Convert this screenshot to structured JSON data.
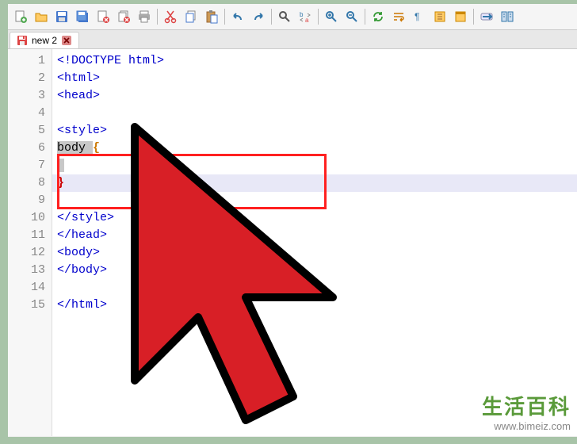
{
  "toolbar": {
    "buttons": [
      {
        "name": "new-file-icon",
        "title": "New"
      },
      {
        "name": "open-file-icon",
        "title": "Open"
      },
      {
        "name": "save-icon",
        "title": "Save"
      },
      {
        "name": "save-all-icon",
        "title": "Save All"
      },
      {
        "name": "close-icon",
        "title": "Close"
      },
      {
        "name": "close-all-icon",
        "title": "Close All"
      },
      {
        "name": "print-icon",
        "title": "Print"
      },
      {
        "name": "sep"
      },
      {
        "name": "cut-icon",
        "title": "Cut"
      },
      {
        "name": "copy-icon",
        "title": "Copy"
      },
      {
        "name": "paste-icon",
        "title": "Paste"
      },
      {
        "name": "sep"
      },
      {
        "name": "undo-icon",
        "title": "Undo"
      },
      {
        "name": "redo-icon",
        "title": "Redo"
      },
      {
        "name": "sep"
      },
      {
        "name": "find-icon",
        "title": "Find"
      },
      {
        "name": "replace-icon",
        "title": "Replace"
      },
      {
        "name": "sep"
      },
      {
        "name": "zoom-in-icon",
        "title": "Zoom In"
      },
      {
        "name": "zoom-out-icon",
        "title": "Zoom Out"
      },
      {
        "name": "sep"
      },
      {
        "name": "sync-icon",
        "title": "Sync"
      },
      {
        "name": "wrap-icon",
        "title": "Word Wrap"
      },
      {
        "name": "chars-icon",
        "title": "Show Chars"
      },
      {
        "name": "indent-icon",
        "title": "Indent Guide"
      },
      {
        "name": "folder-icon",
        "title": "Explorer"
      },
      {
        "name": "sep"
      },
      {
        "name": "macro-rec-icon",
        "title": "Record"
      },
      {
        "name": "macro-play-icon",
        "title": "Play"
      }
    ]
  },
  "tab": {
    "label": "new 2",
    "modified": true
  },
  "code": {
    "lines": [
      {
        "n": 1,
        "text": "<!DOCTYPE html>"
      },
      {
        "n": 2,
        "text": "<html>"
      },
      {
        "n": 3,
        "text": "<head>"
      },
      {
        "n": 4,
        "text": ""
      },
      {
        "n": 5,
        "text": "<style>"
      },
      {
        "n": 6,
        "text": "body {",
        "sel": "body ",
        "brace": "open"
      },
      {
        "n": 7,
        "text": " ",
        "sel": " "
      },
      {
        "n": 8,
        "text": "}",
        "brace": "close",
        "current": true
      },
      {
        "n": 9,
        "text": ""
      },
      {
        "n": 10,
        "text": "</style>"
      },
      {
        "n": 11,
        "text": "</head>"
      },
      {
        "n": 12,
        "text": "<body>"
      },
      {
        "n": 13,
        "text": "</body>"
      },
      {
        "n": 14,
        "text": ""
      },
      {
        "n": 15,
        "text": "</html>"
      }
    ]
  },
  "watermark": {
    "cn": "生活百科",
    "url": "www.bimeiz.com"
  }
}
